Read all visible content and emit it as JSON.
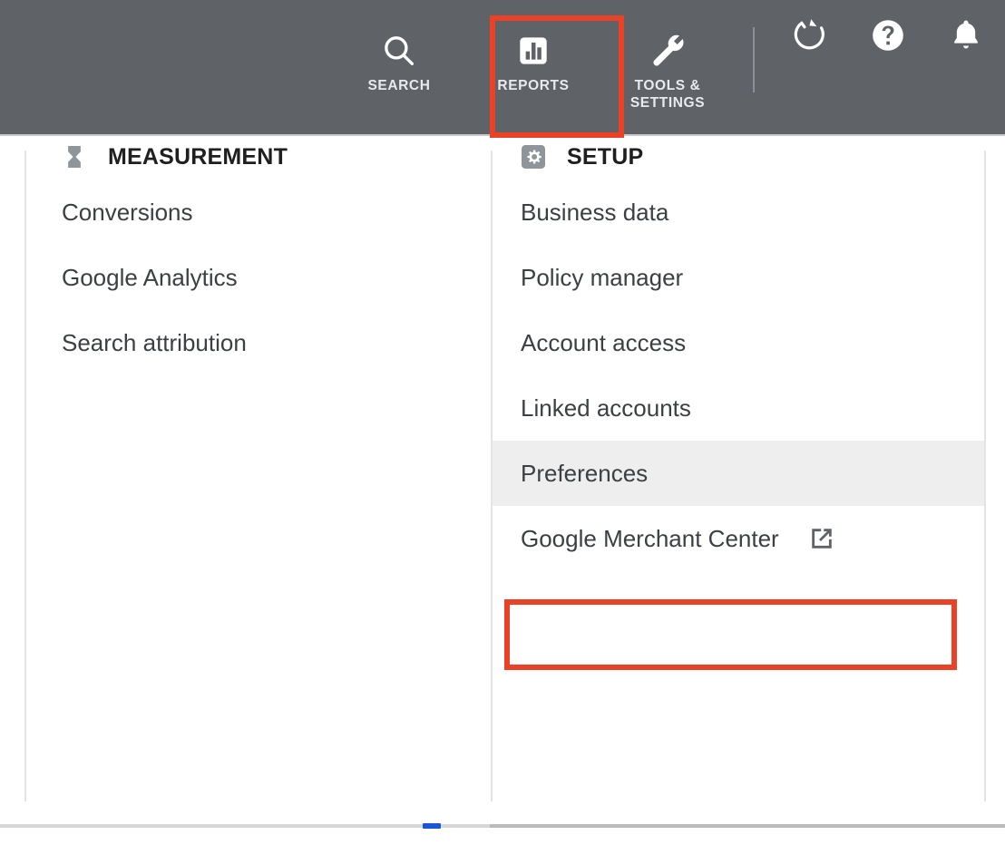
{
  "topbar": {
    "background_color": "#5F6368",
    "nav_items": [
      {
        "id": "search",
        "label": "Search",
        "icon": "search-icon"
      },
      {
        "id": "reports",
        "label": "Reports",
        "icon": "bar-chart-icon"
      },
      {
        "id": "tools-settings",
        "label": "Tools &\nSettings",
        "label_line1": "TOOLS &",
        "label_line2": "SETTINGS",
        "icon": "wrench-icon",
        "active": true
      }
    ],
    "actions": [
      {
        "id": "refresh",
        "label": "Refresh",
        "icon": "refresh-icon"
      },
      {
        "id": "help",
        "label": "Help",
        "icon": "help-circle-icon"
      },
      {
        "id": "notifications",
        "label": "Notifications",
        "icon": "bell-icon"
      }
    ]
  },
  "panel": {
    "columns": [
      {
        "id": "measurement",
        "header": "MEASUREMENT",
        "header_icon": "hourglass-icon",
        "items": [
          {
            "label": "Conversions",
            "external": false,
            "highlighted": false
          },
          {
            "label": "Google Analytics",
            "external": false,
            "highlighted": false
          },
          {
            "label": "Search attribution",
            "external": false,
            "highlighted": false
          }
        ]
      },
      {
        "id": "setup",
        "header": "SETUP",
        "header_icon": "gear-icon",
        "items": [
          {
            "label": "Business data",
            "external": false,
            "highlighted": false
          },
          {
            "label": "Policy manager",
            "external": false,
            "highlighted": false
          },
          {
            "label": "Account access",
            "external": false,
            "highlighted": false
          },
          {
            "label": "Linked accounts",
            "external": false,
            "highlighted": false
          },
          {
            "label": "Preferences",
            "external": false,
            "highlighted": true
          },
          {
            "label": "Google Merchant Center",
            "external": true,
            "highlighted": false
          }
        ]
      }
    ]
  },
  "annotations": {
    "color": "#EA4127",
    "boxes": [
      {
        "target": "tools-settings-nav-item",
        "label": "Tools & Settings"
      },
      {
        "target": "menu-item-preferences",
        "label": "Preferences"
      }
    ]
  }
}
